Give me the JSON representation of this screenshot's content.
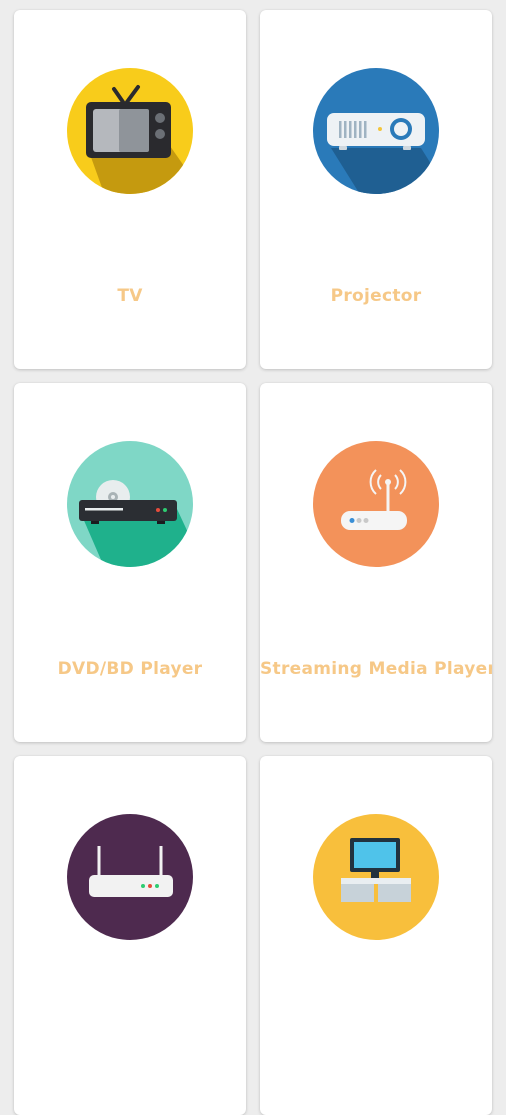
{
  "colors": {
    "background": "#ededed",
    "card": "#ffffff",
    "label": "#f6c887"
  },
  "devices": [
    {
      "label": "TV",
      "icon": "tv-icon",
      "circle_color": "#f8cc1b"
    },
    {
      "label": "Projector",
      "icon": "projector-icon",
      "circle_color": "#2a7ab9"
    },
    {
      "label": "DVD/BD Player",
      "icon": "dvd-player-icon",
      "circle_color": "#7fd7c6"
    },
    {
      "label": "Streaming Media Player",
      "icon": "streaming-player-icon",
      "circle_color": "#f3925a"
    },
    {
      "label": "",
      "icon": "router-icon",
      "circle_color": "#4e2a4f"
    },
    {
      "label": "",
      "icon": "tv-stand-icon",
      "circle_color": "#f8bf3c"
    }
  ]
}
